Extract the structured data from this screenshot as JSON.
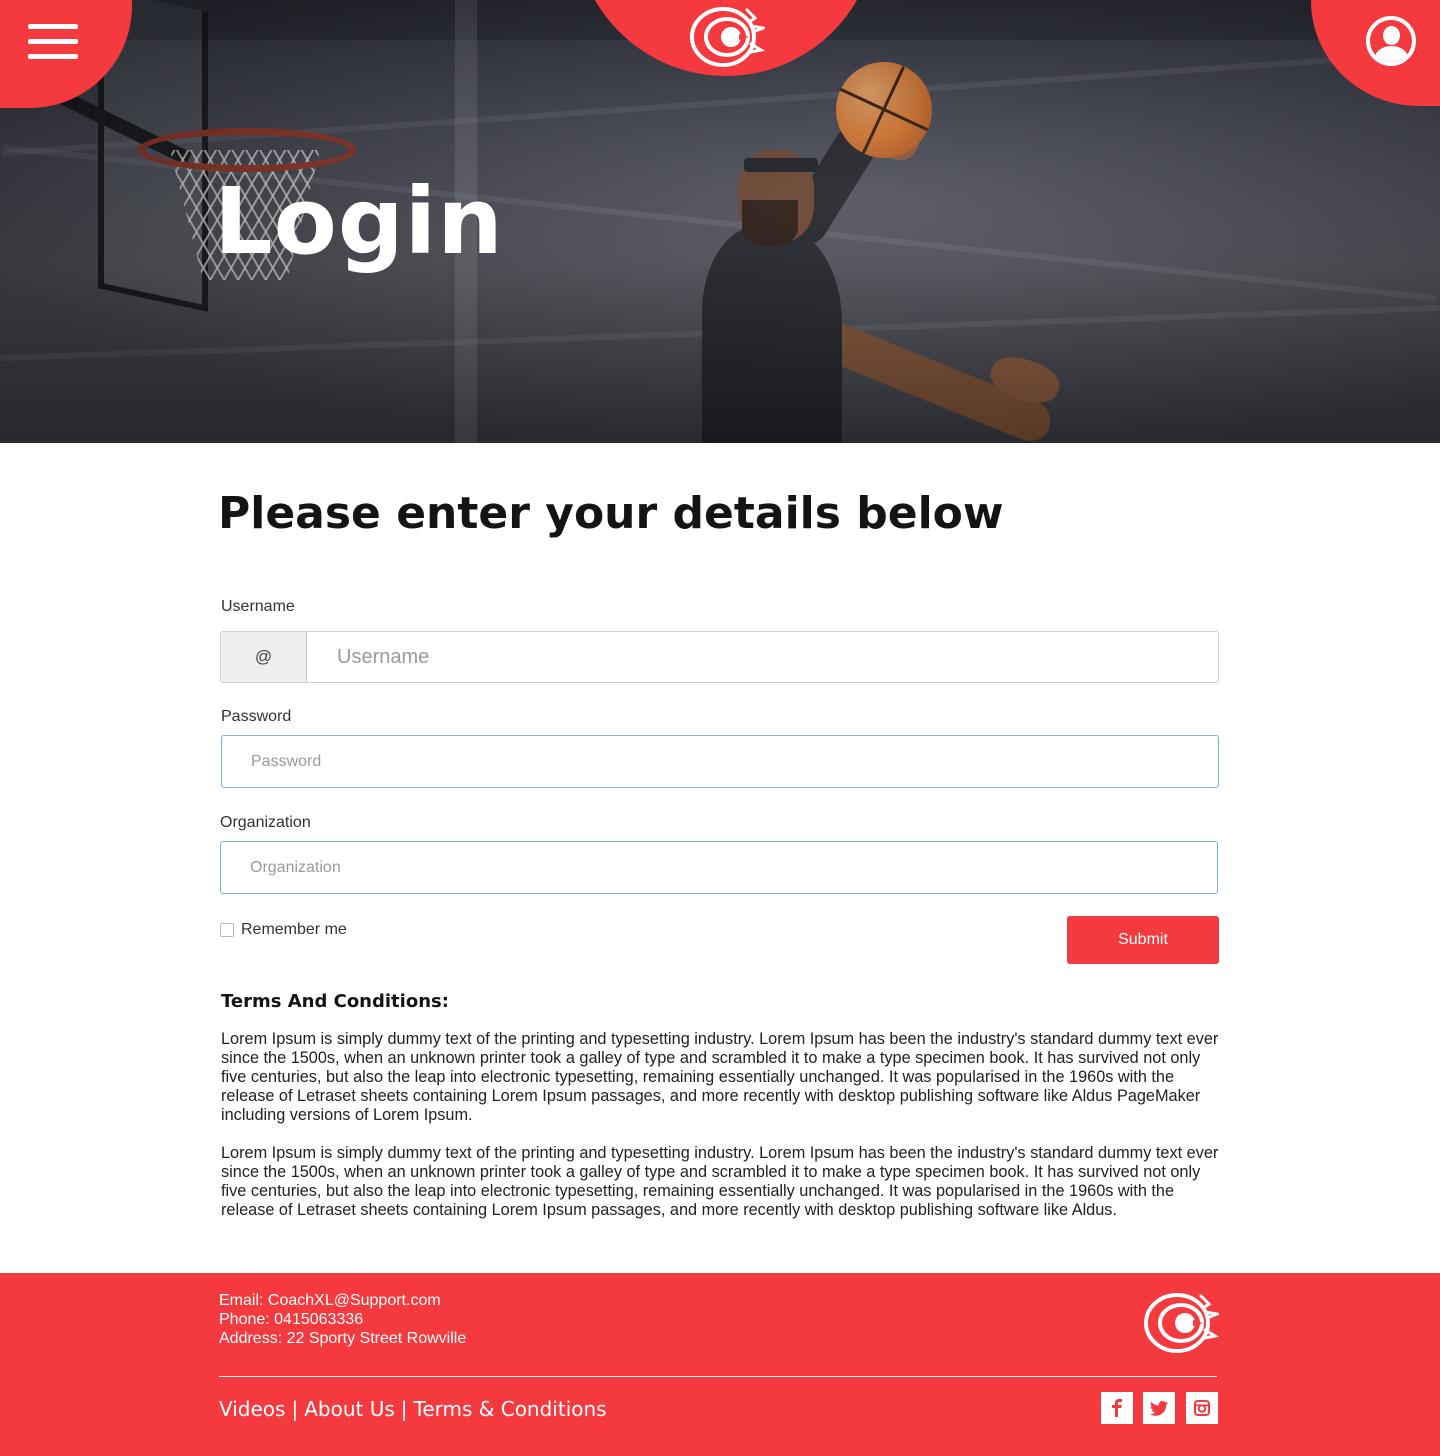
{
  "header": {
    "menu_icon": "hamburger-menu-icon",
    "logo_icon": "coachxl-logo-icon",
    "user_icon": "user-profile-icon",
    "accent_color": "#f43a3f"
  },
  "hero": {
    "title": "Login"
  },
  "form": {
    "heading": "Please enter your details below",
    "username": {
      "label": "Username",
      "addon": "@",
      "placeholder": "Username",
      "value": ""
    },
    "password": {
      "label": "Password",
      "placeholder": "Password",
      "value": ""
    },
    "organization": {
      "label": "Organization",
      "placeholder": "Organization",
      "value": ""
    },
    "remember_label": "Remember me",
    "remember_checked": false,
    "submit_label": "Submit"
  },
  "terms": {
    "title": "Terms And Conditions:",
    "paragraphs": [
      "Lorem Ipsum is simply dummy text of the printing and typesetting industry. Lorem Ipsum has been the industry's standard dummy text ever since the 1500s, when an unknown printer took a galley of type and scrambled it to make a type specimen book. It has survived not only five centuries, but also the leap into electronic typesetting, remaining essentially unchanged. It was popularised in the 1960s with the release of Letraset sheets containing Lorem Ipsum passages, and more recently with desktop publishing software like Aldus PageMaker including versions of Lorem Ipsum.",
      "Lorem Ipsum is simply dummy text of the printing and typesetting industry. Lorem Ipsum has been the industry's standard dummy text ever since the 1500s, when an unknown printer took a galley of type and scrambled it to make a type specimen book. It has survived not only five centuries, but also the leap into electronic typesetting, remaining essentially unchanged. It was popularised in the 1960s with the release of Letraset sheets containing Lorem Ipsum passages, and more recently with desktop publishing software like Aldus."
    ]
  },
  "footer": {
    "email": "Email: CoachXL@Support.com",
    "phone": "Phone: 0415063336",
    "address": "Address: 22 Sporty Street Rowville",
    "links": [
      "Videos",
      "About Us",
      "Terms & Conditions"
    ],
    "separator": "|",
    "social": [
      {
        "name": "facebook-icon",
        "glyph": "f"
      },
      {
        "name": "twitter-icon",
        "glyph": "t"
      },
      {
        "name": "instagram-icon",
        "glyph": "i"
      }
    ]
  }
}
